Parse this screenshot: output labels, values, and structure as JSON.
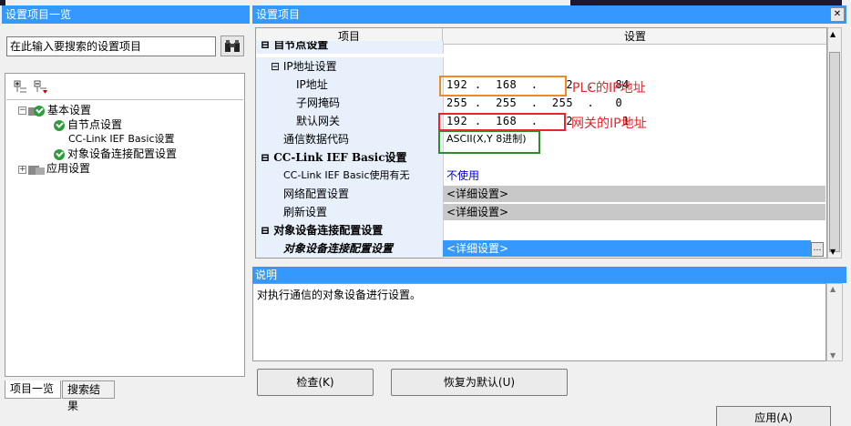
{
  "left_panel": {
    "title": "设置项目一览",
    "search_placeholder": "在此输入要搜索的设置项目",
    "tree": [
      {
        "label": "基本设置",
        "expanded": true
      },
      {
        "label": "自节点设置"
      },
      {
        "label": "CC-Link IEF Basic设置"
      },
      {
        "label": "对象设备连接配置设置"
      },
      {
        "label": "应用设置",
        "expanded": false
      }
    ],
    "tabs": [
      "项目一览",
      "搜索结果"
    ]
  },
  "right_panel": {
    "title": "设置项目",
    "columns": [
      "项目",
      "设置"
    ],
    "rows": {
      "group_self": "自节点设置",
      "group_ip": "IP地址设置",
      "ip_label": "IP地址",
      "ip_value": [
        "192",
        "168",
        "2",
        "84"
      ],
      "subnet_label": "子网掩码",
      "subnet_value": [
        "255",
        "255",
        "255",
        "0"
      ],
      "gateway_label": "默认网关",
      "gateway_value": [
        "192",
        "168",
        "2",
        "1"
      ],
      "code_label": "通信数据代码",
      "code_value": "ASCII(X,Y 8进制)",
      "group_cclink": "CC-Link IEF Basic设置",
      "cclink_use_label": "CC-Link IEF Basic使用有无",
      "cclink_use_value": "不使用",
      "network_label": "网络配置设置",
      "network_value": "<详细设置>",
      "refresh_label": "刷新设置",
      "refresh_value": "<详细设置>",
      "group_target": "对象设备连接配置设置",
      "target_label": "对象设备连接配置设置",
      "target_value": "<详细设置>"
    },
    "annotations": {
      "plc_ip": "PLC的IP地址",
      "gateway_ip": "网关的IP地址"
    },
    "description": {
      "title": "说明",
      "text": "对执行通信的对象设备进行设置。"
    },
    "buttons": {
      "check": "检查(K)",
      "restore": "恢复为默认(U)",
      "apply": "应用(A)"
    }
  },
  "colors": {
    "title_bar": "#3399ff",
    "annot_orange": "#f08a24",
    "annot_red": "#e8262a",
    "annot_green": "#2e8b2e"
  }
}
